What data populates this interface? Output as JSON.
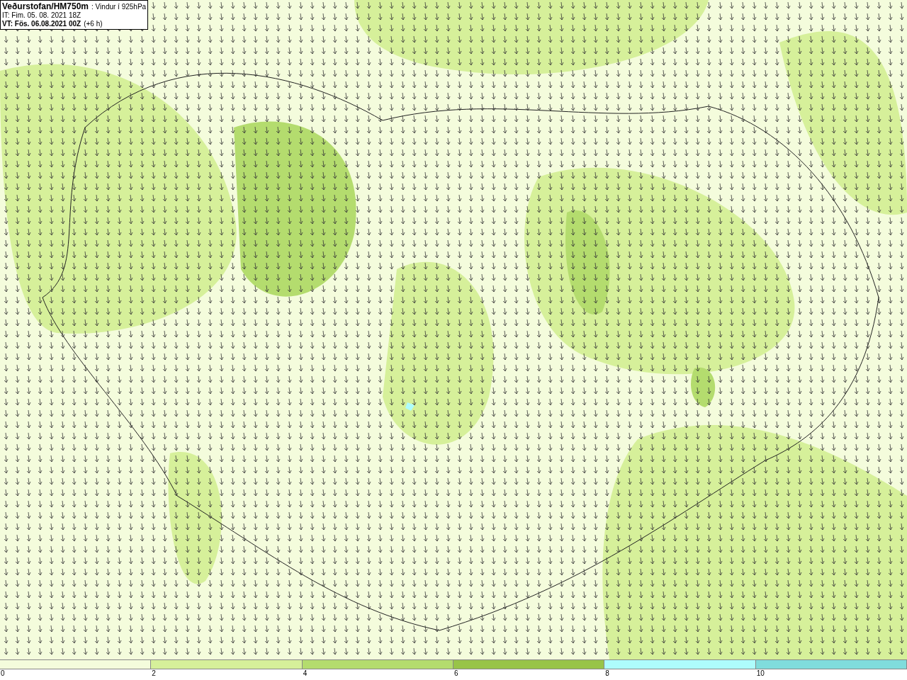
{
  "header": {
    "source": "Veðurstofan/HM750m",
    "product": ": Vindur í 925hPa",
    "init_time": "IT: Fim. 05. 08. 2021 18Z",
    "valid_label": "VT: Fös. 06.08.2021 00Z",
    "valid_offset": "(+6 h)"
  },
  "legend": {
    "bins": [
      {
        "color": "#f4fcdc"
      },
      {
        "color": "#d6f09a"
      },
      {
        "color": "#b4dc6e"
      },
      {
        "color": "#98c448"
      },
      {
        "color": "#aefcfc"
      },
      {
        "color": "#80dcdc"
      }
    ],
    "ticks": [
      "0",
      "2",
      "4",
      "6",
      "8",
      "10"
    ]
  }
}
